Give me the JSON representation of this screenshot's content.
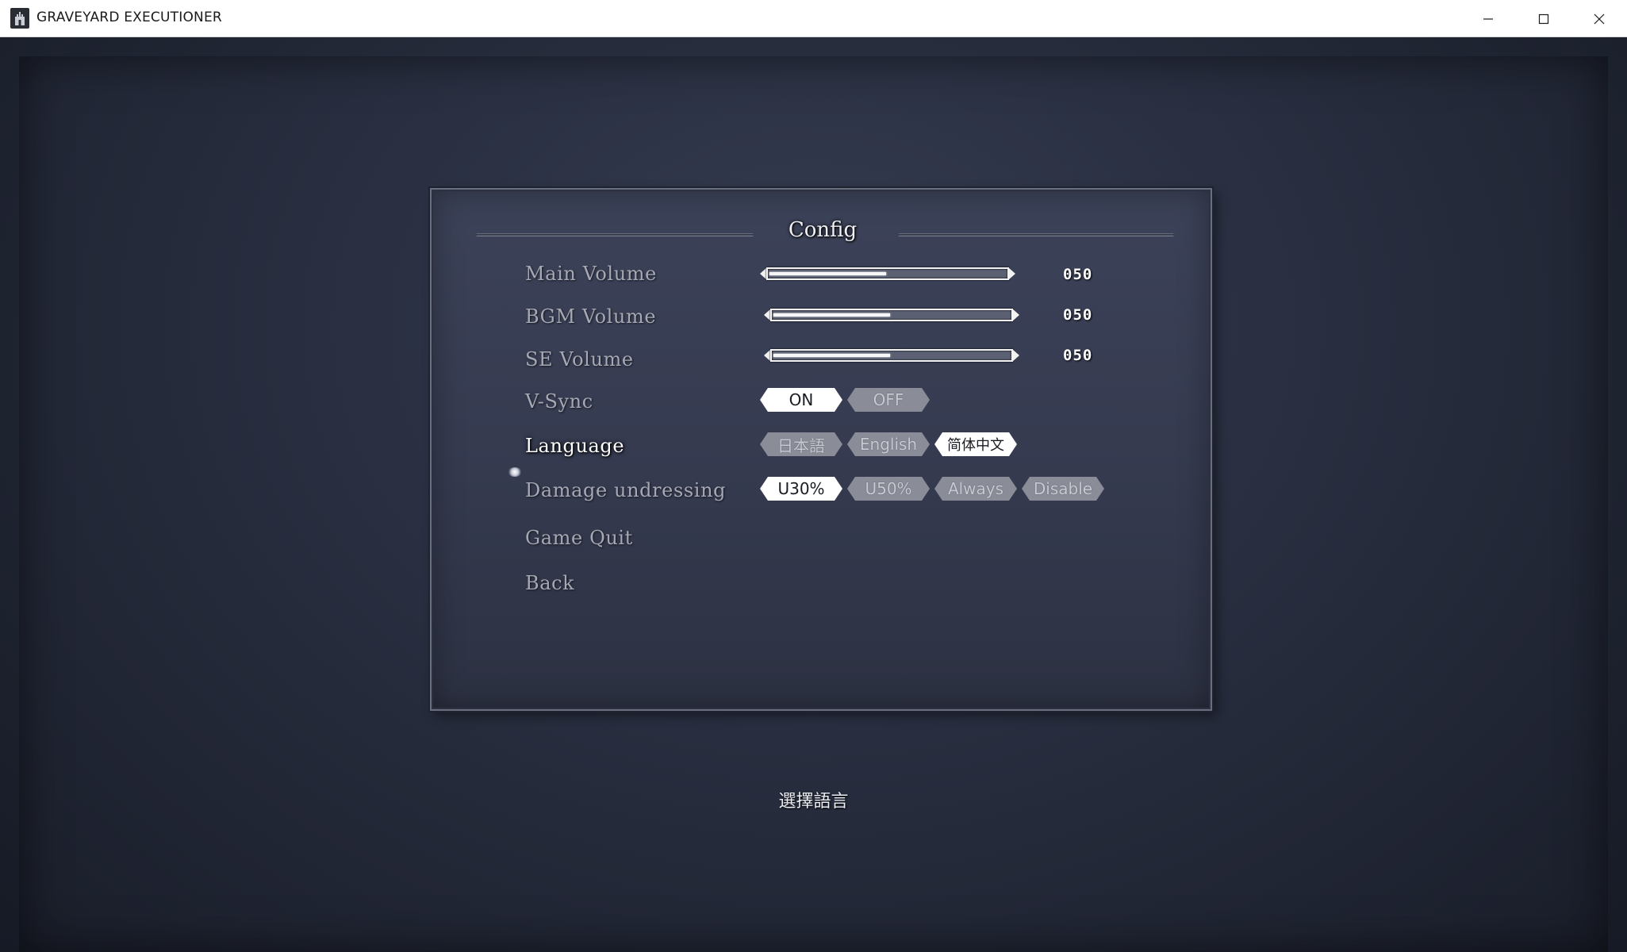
{
  "window": {
    "title": "GRAVEYARD EXECUTIONER",
    "icon": "castle-app-icon",
    "controls": [
      "minimize-icon",
      "maximize-icon",
      "close-icon"
    ]
  },
  "config": {
    "title": "Config",
    "items": {
      "main_volume": {
        "label": "Main Volume",
        "value": "050",
        "level": 0.5
      },
      "bgm_volume": {
        "label": "BGM Volume",
        "value": "050",
        "level": 0.5
      },
      "se_volume": {
        "label": "SE Volume",
        "value": "050",
        "level": 0.5
      },
      "vsync": {
        "label": "V-Sync",
        "options": [
          "ON",
          "OFF"
        ],
        "selected": "ON"
      },
      "language": {
        "label": "Language",
        "options": [
          "日本語",
          "English",
          "简体中文"
        ],
        "selected": "简体中文"
      },
      "damage_undressing": {
        "label": "Damage undressing",
        "options": [
          "U30%",
          "U50%",
          "Always",
          "Disable"
        ],
        "selected": "U30%"
      },
      "game_quit": {
        "label": "Game Quit"
      },
      "back": {
        "label": "Back"
      }
    },
    "cursor_on": "Language"
  },
  "help_text": "選擇語言",
  "colors": {
    "background": "#252b3a",
    "panel": "#383d52",
    "label_inactive": "#a6a9b3",
    "label_active": "#ffffff",
    "option_selected": "#ffffff",
    "option_unselected": "#8a8d98"
  }
}
